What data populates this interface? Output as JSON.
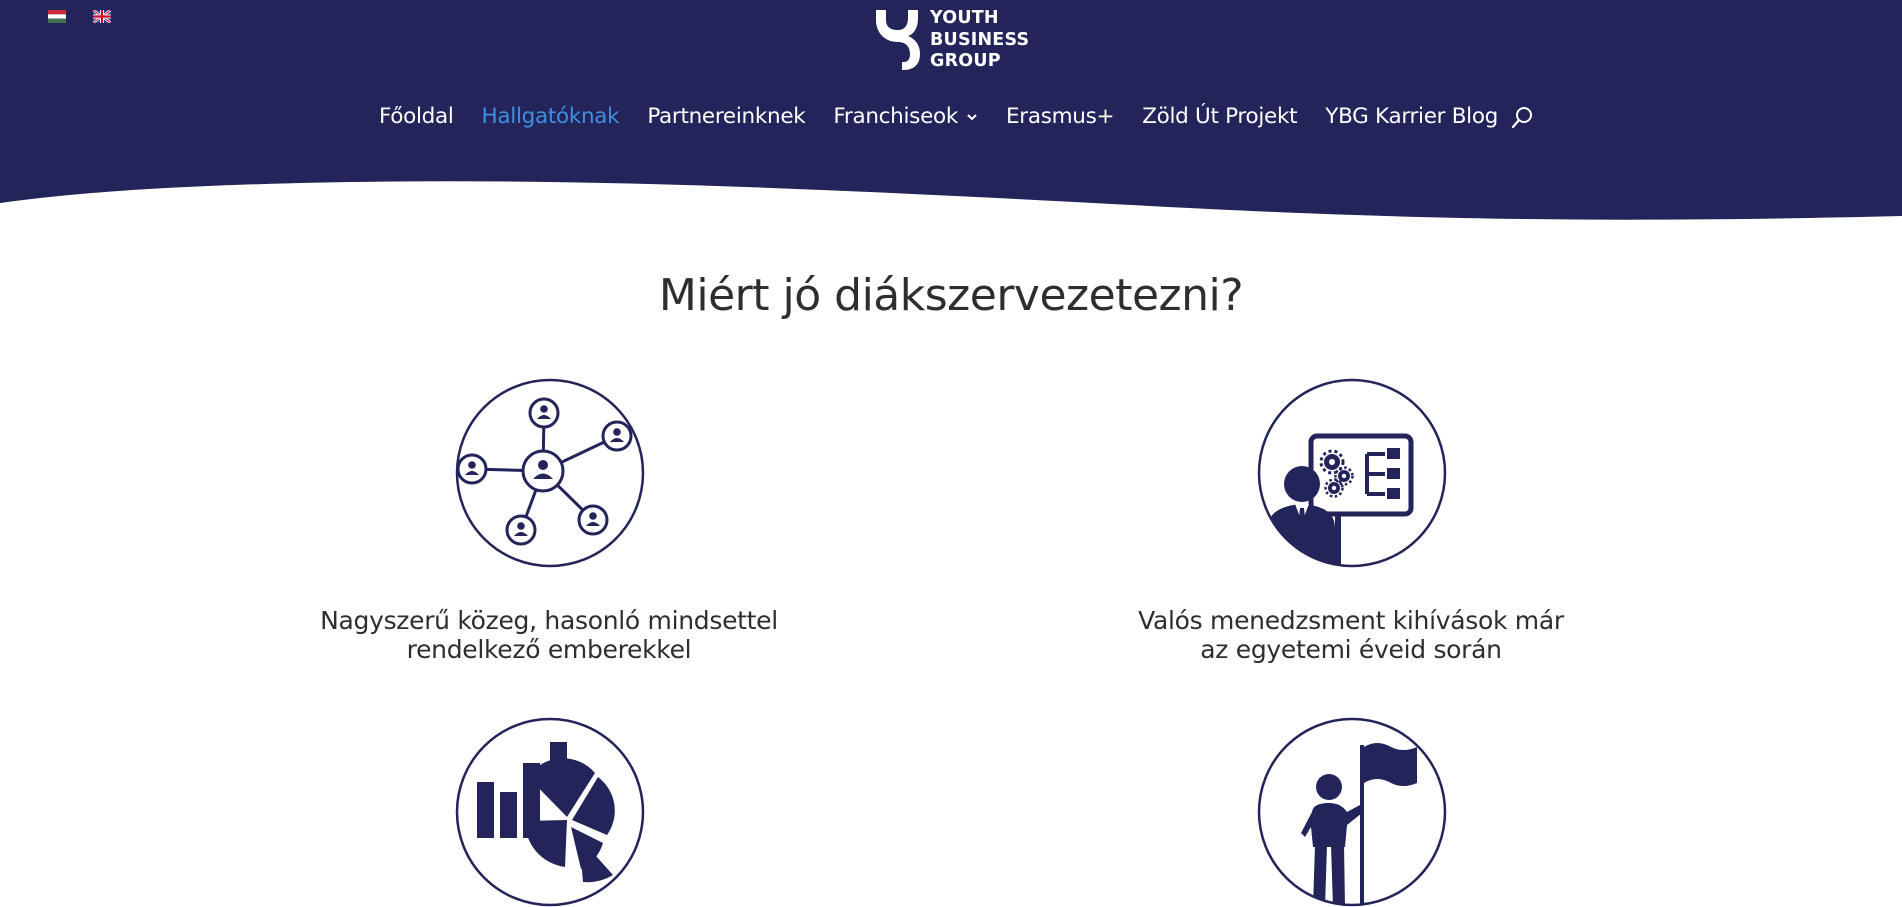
{
  "language_switcher": [
    {
      "code": "hu",
      "label": "Magyar"
    },
    {
      "code": "en",
      "label": "English"
    }
  ],
  "logo": {
    "line1": "YOUTH",
    "line2": "BUSINESS",
    "line3": "GROUP"
  },
  "nav": {
    "items": [
      {
        "label": "Főoldal",
        "active": false
      },
      {
        "label": "Hallgatóknak",
        "active": true
      },
      {
        "label": "Partnereinknek",
        "active": false
      },
      {
        "label": "Franchiseok",
        "active": false,
        "has_dropdown": true
      },
      {
        "label": "Erasmus+",
        "active": false
      },
      {
        "label": "Zöld Út Projekt",
        "active": false
      },
      {
        "label": "YBG Karrier Blog",
        "active": false
      }
    ],
    "search_icon": "search-icon"
  },
  "section": {
    "title": "Miért jó diákszervezetezni?"
  },
  "features": [
    {
      "icon": "network-people-icon",
      "line1": "Nagyszerű közeg, hasonló mindsettel",
      "line2": "rendelkező emberekkel"
    },
    {
      "icon": "manager-presentation-icon",
      "line1": "Valós menedzsment kihívások már",
      "line2": "az egyetemi éveid során"
    },
    {
      "icon": "charts-icon",
      "line1": "",
      "line2": ""
    },
    {
      "icon": "person-flag-icon",
      "line1": "",
      "line2": ""
    }
  ],
  "colors": {
    "navy": "#22245a",
    "active_link": "#3f8ee0",
    "text": "#2e2e2e",
    "white": "#ffffff"
  }
}
